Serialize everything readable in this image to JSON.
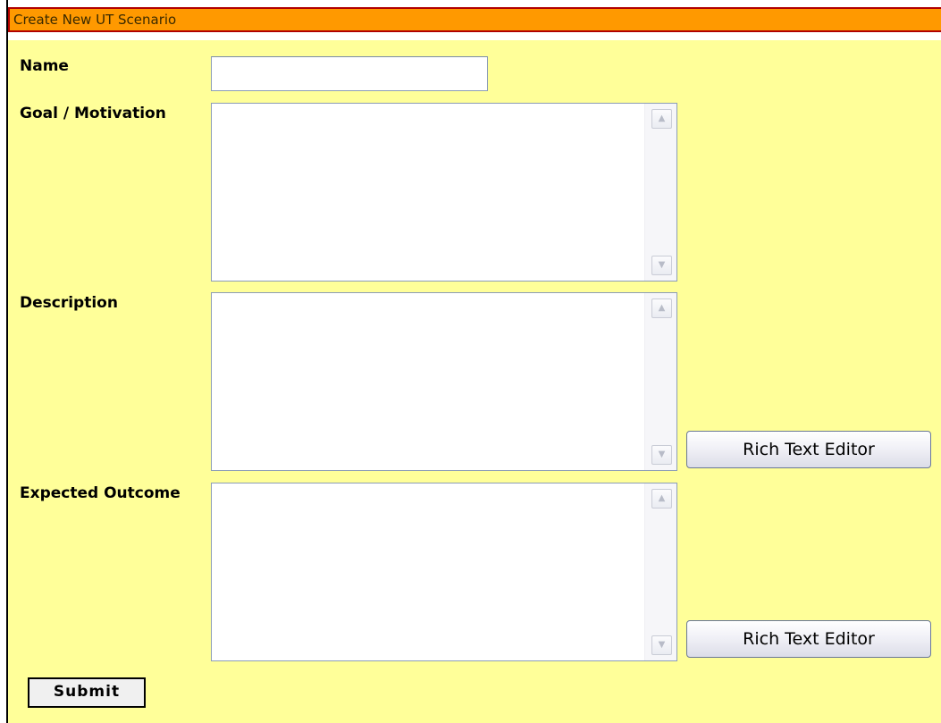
{
  "form": {
    "title": "Create New UT Scenario",
    "fields": {
      "name": {
        "label": "Name",
        "value": "",
        "placeholder": ""
      },
      "goal": {
        "label": "Goal / Motivation",
        "value": ""
      },
      "description": {
        "label": "Description",
        "value": ""
      },
      "expected": {
        "label": "Expected Outcome",
        "value": ""
      }
    },
    "rich_text_label": "Rich Text Editor",
    "submit_label": "Submit"
  },
  "icons": {
    "scroll_up": "chevron-up-icon",
    "scroll_down": "chevron-down-icon"
  },
  "colors": {
    "title_bar": "#ff9900",
    "title_border": "#b00000",
    "form_background": "#ffff99"
  }
}
